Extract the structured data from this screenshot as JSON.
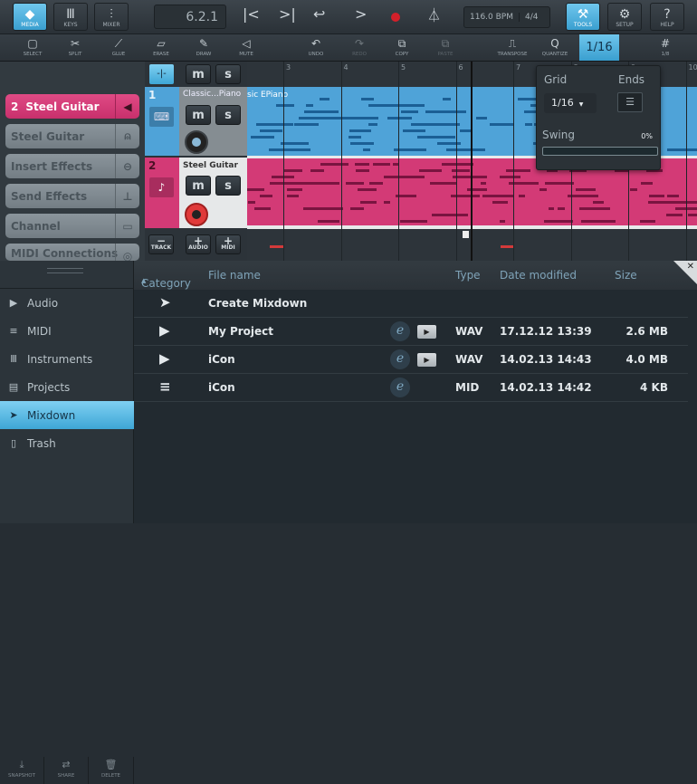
{
  "topbar": {
    "media": "MEDIA",
    "keys": "KEYS",
    "mixer": "MIXER",
    "position": "6.2.1",
    "tempo": "116.0 BPM",
    "signature": "4/4",
    "tools": "TOOLS",
    "setup": "SETUP",
    "help": "HELP"
  },
  "toolbar": {
    "select": "SELECT",
    "split": "SPLIT",
    "glue": "GLUE",
    "erase": "ERASE",
    "draw": "DRAW",
    "mute": "MUTE",
    "undo": "UNDO",
    "redo": "REDO",
    "copy": "COPY",
    "paste": "PASTE",
    "transpose": "TRANSPOSE",
    "quantize": "QUANTIZE",
    "quantize_value": "1/16",
    "grid_label": "1/8"
  },
  "inspector": {
    "selected_number": "2",
    "selected_name": "Steel Guitar",
    "items": [
      "Steel Guitar",
      "Insert Effects",
      "Send Effects",
      "Channel",
      "MIDI Connections"
    ]
  },
  "tracks": [
    {
      "number": "1",
      "name": "Classic...Piano",
      "part_label": "sic EPiano",
      "color": "#4fa3d8"
    },
    {
      "number": "2",
      "name": "Steel Guitar",
      "color": "#d33a76"
    }
  ],
  "track_buttons": {
    "mute": "m",
    "solo": "s",
    "remove_track": "TRACK",
    "add_audio": "AUDIO",
    "add_midi": "MIDI"
  },
  "ruler": [
    "3",
    "4",
    "5",
    "6",
    "7",
    "8",
    "9",
    "10"
  ],
  "quantize_popup": {
    "grid_label": "Grid",
    "grid_value": "1/16",
    "ends_label": "Ends",
    "swing_label": "Swing",
    "swing_value": "0%",
    "swing": 0
  },
  "browser": {
    "categories": [
      {
        "label": "Audio",
        "icon": "play-icon"
      },
      {
        "label": "MIDI",
        "icon": "midi-icon"
      },
      {
        "label": "Instruments",
        "icon": "instruments-icon"
      },
      {
        "label": "Projects",
        "icon": "projects-icon"
      },
      {
        "label": "Mixdown",
        "icon": "mixdown-icon",
        "selected": true
      },
      {
        "label": "Trash",
        "icon": "trash-icon"
      }
    ],
    "bottom_buttons": [
      "SNAPSHOT",
      "SHARE",
      "DELETE"
    ],
    "columns": {
      "category": "Category",
      "filename": "File name",
      "type": "Type",
      "date": "Date modified",
      "size": "Size"
    },
    "rows": [
      {
        "icon": "mixdown-icon",
        "name": "Create Mixdown",
        "type": "",
        "date": "",
        "size": ""
      },
      {
        "icon": "audio-icon",
        "name": "My Project",
        "type": "WAV",
        "date": "17.12.12 13:39",
        "size": "2.6 MB"
      },
      {
        "icon": "audio-icon",
        "name": "iCon",
        "type": "WAV",
        "date": "14.02.13 14:43",
        "size": "4.0 MB"
      },
      {
        "icon": "midi-icon",
        "name": "iCon",
        "type": "MID",
        "date": "14.02.13 14:42",
        "size": "4 KB"
      }
    ]
  },
  "colors": {
    "accent": "#3ea6d6",
    "track_pink": "#d33a76",
    "track_blue": "#4fa3d8"
  }
}
